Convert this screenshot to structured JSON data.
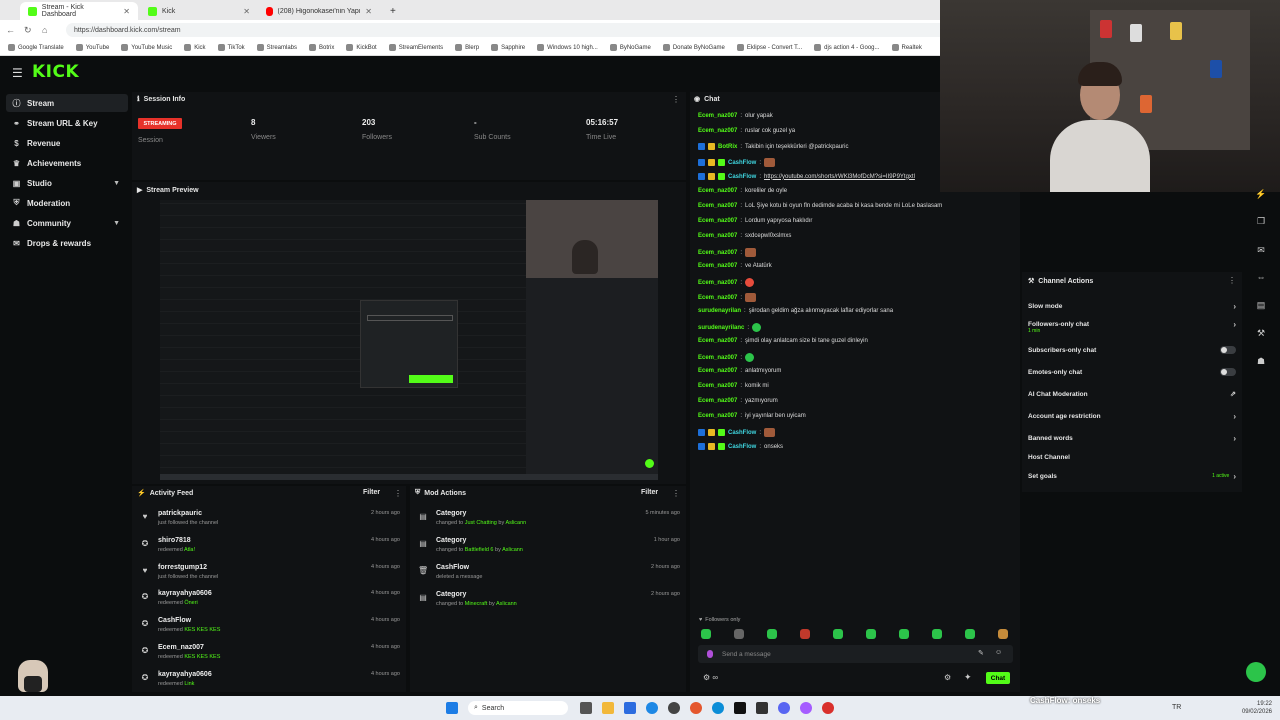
{
  "browser": {
    "tabs": [
      {
        "title": "Stream - Kick Dashboard",
        "active": true
      },
      {
        "title": "Kick",
        "active": false
      },
      {
        "title": "(208) Higonokasei'nin Yapımı Japo...",
        "active": false
      }
    ],
    "url": "https://dashboard.kick.com/stream",
    "bookmarks": [
      "Google Translate",
      "YouTube",
      "YouTube Music",
      "Kick",
      "TikTok",
      "Streamlabs",
      "Botrix",
      "KickBot",
      "StreamElements",
      "Blerp",
      "Sapphire",
      "Windows 10 high...",
      "ByNoGame",
      "Donate ByNoGame",
      "Eklipse - Convert T...",
      "djs action 4 - Goog...",
      "Realtek"
    ]
  },
  "app": {
    "logo": "KICK"
  },
  "sidebar": {
    "items": [
      {
        "label": "Stream",
        "icon": "info-icon",
        "active": true,
        "expand": false
      },
      {
        "label": "Stream URL & Key",
        "icon": "link-icon",
        "active": false,
        "expand": false
      },
      {
        "label": "Revenue",
        "icon": "revenue-icon",
        "active": false,
        "expand": false
      },
      {
        "label": "Achievements",
        "icon": "trophy-icon",
        "active": false,
        "expand": false
      },
      {
        "label": "Studio",
        "icon": "studio-icon",
        "active": false,
        "expand": true
      },
      {
        "label": "Moderation",
        "icon": "shield-icon",
        "active": false,
        "expand": false
      },
      {
        "label": "Community",
        "icon": "community-icon",
        "active": false,
        "expand": true
      },
      {
        "label": "Drops & rewards",
        "icon": "gift-icon",
        "active": false,
        "expand": false
      }
    ]
  },
  "session": {
    "title": "Session Info",
    "badge": "STREAMING",
    "session_label": "Session",
    "stats": [
      {
        "value": "8",
        "label": "Viewers"
      },
      {
        "value": "203",
        "label": "Followers"
      },
      {
        "value": "-",
        "label": "Sub Counts"
      },
      {
        "value": "05:16:57",
        "label": "Time Live"
      }
    ]
  },
  "preview": {
    "title": "Stream Preview"
  },
  "activity_feed": {
    "title": "Activity Feed",
    "filter": "Filter",
    "items": [
      {
        "icon": "heart-icon",
        "name": "patrickpauric",
        "action": "just followed the channel",
        "highlight": "",
        "time": "2 hours ago"
      },
      {
        "icon": "reward-icon",
        "name": "shiro7818",
        "action": "redeemed",
        "highlight": "Atla!",
        "time": "4 hours ago"
      },
      {
        "icon": "heart-icon",
        "name": "forrestgump12",
        "action": "just followed the channel",
        "highlight": "",
        "time": "4 hours ago"
      },
      {
        "icon": "reward-icon",
        "name": "kayrayahya0606",
        "action": "redeemed",
        "highlight": "Öneri",
        "time": "4 hours ago"
      },
      {
        "icon": "reward-icon",
        "name": "CashFlow",
        "action": "redeemed",
        "highlight": "KES KES KES",
        "time": "4 hours ago"
      },
      {
        "icon": "reward-icon",
        "name": "Ecem_naz007",
        "action": "redeemed",
        "highlight": "KES KES KES",
        "time": "4 hours ago"
      },
      {
        "icon": "reward-icon",
        "name": "kayrayahya0606",
        "action": "redeemed",
        "highlight": "Link",
        "time": "4 hours ago"
      }
    ]
  },
  "mod_actions": {
    "title": "Mod Actions",
    "filter": "Filter",
    "items": [
      {
        "icon": "category-icon",
        "name": "Category",
        "pre": "changed to",
        "target": "Just Chatting",
        "by": "by",
        "mod": "Aslicann",
        "time": "5 minutes ago"
      },
      {
        "icon": "category-icon",
        "name": "Category",
        "pre": "changed to",
        "target": "Battlefield 6",
        "by": "by",
        "mod": "Aslicann",
        "time": "1 hour ago"
      },
      {
        "icon": "trash-icon",
        "name": "CashFlow",
        "pre": "deleted a message",
        "target": "",
        "by": "",
        "mod": "",
        "time": "2 hours ago"
      },
      {
        "icon": "category-icon",
        "name": "Category",
        "pre": "changed to",
        "target": "Minecraft",
        "by": "by",
        "mod": "Aslicann",
        "time": "2 hours ago"
      }
    ]
  },
  "chat": {
    "title": "Chat",
    "messages": [
      {
        "user": "Ecem_naz007",
        "color": "green",
        "text": "olur yapak",
        "badges": 0,
        "emote": ""
      },
      {
        "user": "Ecem_naz007",
        "color": "green",
        "text": "ruslar cok guzel ya",
        "badges": 0,
        "emote": ""
      },
      {
        "user": "BotRix",
        "color": "green",
        "text": "Takibin için teşekkürleri @patrickpauric",
        "badges": 2,
        "emote": ""
      },
      {
        "user": "CashFlow",
        "color": "teal",
        "text": "",
        "badges": 3,
        "emote": "img"
      },
      {
        "user": "CashFlow",
        "color": "teal",
        "text": "https://youtube.com/shorts/rWKl3MofDcM?si=II9P9Ytgxtl",
        "badges": 3,
        "emote": "",
        "link": true
      },
      {
        "user": "Ecem_naz007",
        "color": "green",
        "text": "koreliler de oyle",
        "badges": 0,
        "emote": ""
      },
      {
        "user": "Ecem_naz007",
        "color": "green",
        "text": "LoL Şiye kotu bi oyun fln dedimde acaba bi kasa bende mi LoLe baslasam",
        "badges": 0,
        "emote": ""
      },
      {
        "user": "Ecem_naz007",
        "color": "green",
        "text": "Lordum yapıyosa haklıdır",
        "badges": 0,
        "emote": ""
      },
      {
        "user": "Ecem_naz007",
        "color": "green",
        "text": "sxdcepwl0xslmxs",
        "badges": 0,
        "emote": ""
      },
      {
        "user": "Ecem_naz007",
        "color": "green",
        "text": "",
        "badges": 0,
        "emote": "img"
      },
      {
        "user": "Ecem_naz007",
        "color": "green",
        "text": "ve Atatürk",
        "badges": 0,
        "emote": ""
      },
      {
        "user": "Ecem_naz007",
        "color": "green",
        "text": "",
        "badges": 0,
        "emote": "red"
      },
      {
        "user": "Ecem_naz007",
        "color": "green",
        "text": "",
        "badges": 0,
        "emote": "img"
      },
      {
        "user": "surudenayrilan",
        "color": "green",
        "text": "şiirodan geldim ağza alınmayacak laflar ediyorlar sana",
        "badges": 0,
        "emote": ""
      },
      {
        "user": "surudenayrilanc",
        "color": "green",
        "text": "",
        "badges": 0,
        "emote": "green"
      },
      {
        "user": "Ecem_naz007",
        "color": "green",
        "text": "şimdi olay anlatcam size bi tane guzel dinleyin",
        "badges": 0,
        "emote": ""
      },
      {
        "user": "Ecem_naz007",
        "color": "green",
        "text": "",
        "badges": 0,
        "emote": "green"
      },
      {
        "user": "Ecem_naz007",
        "color": "green",
        "text": "anlatmıyorum",
        "badges": 0,
        "emote": ""
      },
      {
        "user": "Ecem_naz007",
        "color": "green",
        "text": "komik mi",
        "badges": 0,
        "emote": ""
      },
      {
        "user": "Ecem_naz007",
        "color": "green",
        "text": "yazmıyorum",
        "badges": 0,
        "emote": ""
      },
      {
        "user": "Ecem_naz007",
        "color": "green",
        "text": "iyi yayınlar ben uyicam",
        "badges": 0,
        "emote": ""
      },
      {
        "user": "CashFlow",
        "color": "teal",
        "text": "",
        "badges": 3,
        "emote": "img"
      },
      {
        "user": "CashFlow",
        "color": "teal",
        "text": "onseks",
        "badges": 3,
        "emote": ""
      }
    ],
    "followers_only": "Followers only",
    "input_placeholder": "Send a message",
    "send_label": "Chat"
  },
  "channel_actions": {
    "title": "Channel Actions",
    "rows": [
      {
        "label": "Slow mode",
        "control": "chevron"
      },
      {
        "label": "Followers-only chat",
        "control": "chevron",
        "sub": "1 min"
      },
      {
        "label": "Subscribers-only chat",
        "control": "toggle"
      },
      {
        "label": "Emotes-only chat",
        "control": "toggle"
      },
      {
        "label": "AI Chat Moderation",
        "control": "chart"
      },
      {
        "label": "Account age restriction",
        "control": "chevron"
      },
      {
        "label": "Banned words",
        "control": "chevron"
      },
      {
        "label": "Host Channel",
        "control": "none"
      },
      {
        "label": "Set goals",
        "control": "chevron",
        "extra": "1 active"
      }
    ]
  },
  "overlay": {
    "ticker": "CashFlow: onseks"
  },
  "taskbar": {
    "search_placeholder": "Search",
    "lang": "TR",
    "time": "19:22",
    "date": "09/02/2026"
  },
  "colors": {
    "accent": "#53fc18",
    "live": "#e7322a",
    "bg": "#0b0d0e",
    "panel": "#101214"
  }
}
